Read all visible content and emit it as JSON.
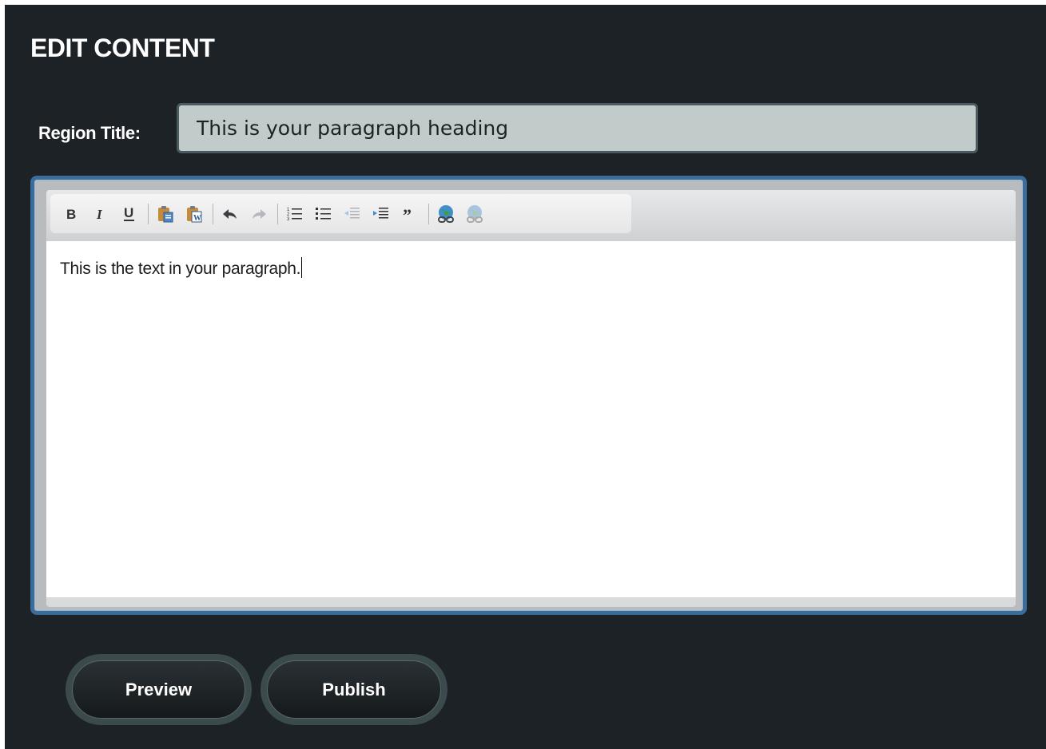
{
  "page": {
    "heading": "EDIT CONTENT"
  },
  "region": {
    "label": "Region Title:",
    "value": "This is your paragraph heading"
  },
  "editor": {
    "toolbar": [
      "bold-icon",
      "italic-icon",
      "underline-icon",
      "paste-text-icon",
      "paste-from-word-icon",
      "undo-icon",
      "redo-icon",
      "numbered-list-icon",
      "bulleted-list-icon",
      "outdent-icon",
      "indent-icon",
      "blockquote-icon",
      "link-icon",
      "unlink-icon"
    ],
    "content": "This is the text in your paragraph."
  },
  "actions": {
    "preview_label": "Preview",
    "publish_label": "Publish"
  },
  "colors": {
    "background": "#1d2226",
    "frame_border": "#3a6d9b",
    "input_bg": "#c0cbca"
  }
}
